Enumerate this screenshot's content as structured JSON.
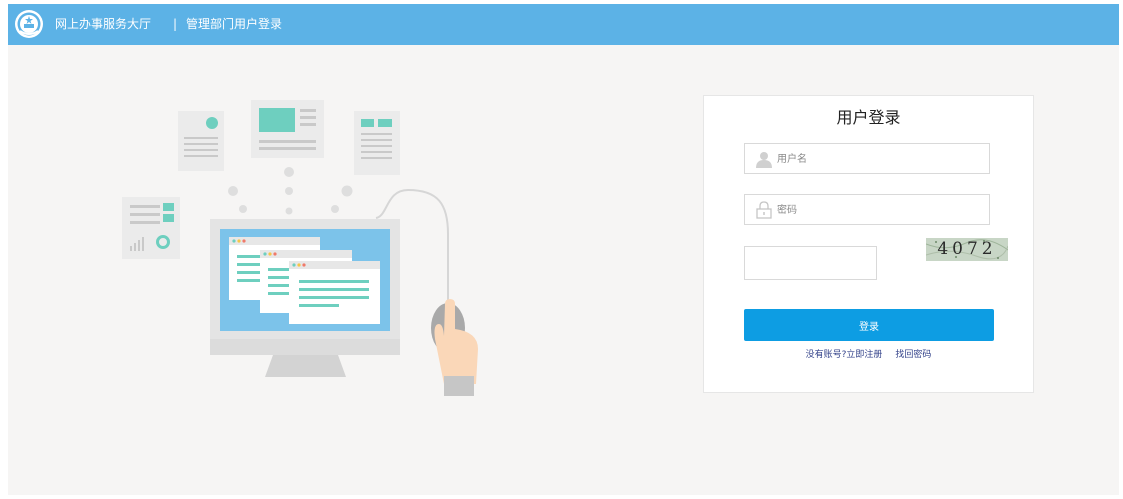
{
  "header": {
    "brand": "网上办事服务大厅",
    "separator": "|",
    "subtitle": "管理部门用户登录",
    "bg_color": "#5cb2e6",
    "emblem_icon": "national-emblem-icon"
  },
  "login": {
    "title": "用户登录",
    "username_placeholder": "用户名",
    "password_placeholder": "密码",
    "captcha_value": "",
    "captcha_text": "4072",
    "submit_label": "登录",
    "register_link": "没有账号?立即注册",
    "forgot_link": "找回密码",
    "button_color": "#0d9de3",
    "link_color": "#33428a",
    "user_icon": "user-icon",
    "lock_icon": "lock-icon"
  },
  "illustration": {
    "name": "computer-with-mouse-illustration"
  }
}
